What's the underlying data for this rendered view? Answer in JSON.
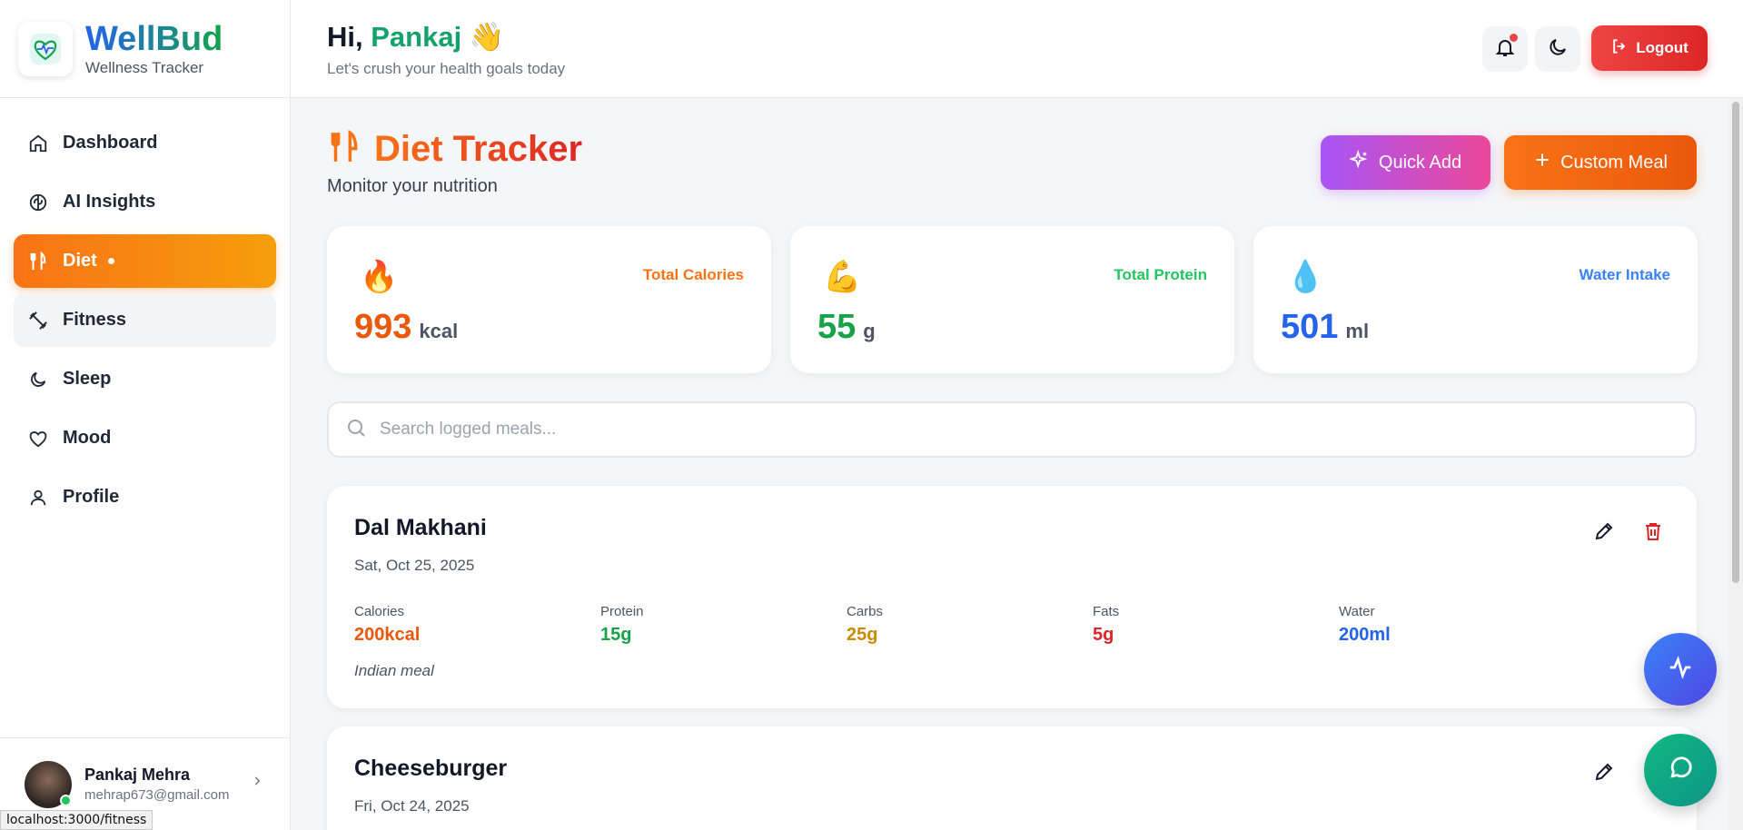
{
  "brand": {
    "name": "WellBud",
    "subtitle": "Wellness Tracker"
  },
  "nav": {
    "items": [
      {
        "label": "Dashboard",
        "icon": "home-icon"
      },
      {
        "label": "AI Insights",
        "icon": "brain-icon"
      },
      {
        "label": "Diet",
        "icon": "utensils-icon",
        "active": true
      },
      {
        "label": "Fitness",
        "icon": "dumbbell-icon"
      },
      {
        "label": "Sleep",
        "icon": "moon-icon"
      },
      {
        "label": "Mood",
        "icon": "heart-icon"
      },
      {
        "label": "Profile",
        "icon": "user-icon"
      }
    ]
  },
  "user": {
    "name": "Pankaj Mehra",
    "email": "mehrap673@gmail.com"
  },
  "status_bar": {
    "url": "localhost:3000/fitness"
  },
  "header": {
    "greeting_prefix": "Hi,",
    "greeting_name": "Pankaj",
    "greeting_emoji": "👋",
    "subtitle": "Let's crush your health goals today",
    "logout_label": "Logout"
  },
  "page": {
    "title": "Diet Tracker",
    "subtitle": "Monitor your nutrition",
    "quick_add_label": "Quick Add",
    "custom_meal_label": "Custom Meal"
  },
  "stats": [
    {
      "label": "Total Calories",
      "value": "993",
      "unit": "kcal",
      "emoji": "🔥",
      "color": "#ea580c",
      "label_color": "#f97316"
    },
    {
      "label": "Total Protein",
      "value": "55",
      "unit": "g",
      "emoji": "💪",
      "color": "#16a34a",
      "label_color": "#22c55e"
    },
    {
      "label": "Water Intake",
      "value": "501",
      "unit": "ml",
      "emoji": "💧",
      "color": "#2563eb",
      "label_color": "#3b82f6"
    }
  ],
  "search": {
    "placeholder": "Search logged meals..."
  },
  "meals": [
    {
      "name": "Dal Makhani",
      "date": "Sat, Oct 25, 2025",
      "calories_label": "Calories",
      "calories": "200kcal",
      "protein_label": "Protein",
      "protein": "15g",
      "carbs_label": "Carbs",
      "carbs": "25g",
      "fats_label": "Fats",
      "fats": "5g",
      "water_label": "Water",
      "water": "200ml",
      "note": "Indian meal"
    },
    {
      "name": "Cheeseburger",
      "date": "Fri, Oct 24, 2025"
    }
  ],
  "colors": {
    "calories": "#ea580c",
    "protein": "#16a34a",
    "carbs": "#ca8a04",
    "fats": "#dc2626",
    "water": "#2563eb",
    "accent_orange": "#f97316",
    "accent_green": "#15a36a"
  }
}
